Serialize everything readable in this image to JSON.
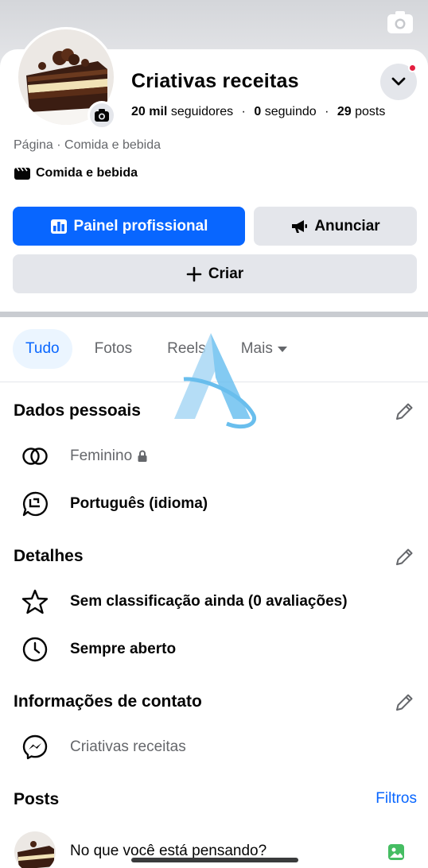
{
  "profile": {
    "name": "Criativas receitas",
    "followers_count": "20 mil",
    "followers_label": "seguidores",
    "following_count": "0",
    "following_label": "seguindo",
    "posts_count": "29",
    "posts_label": "posts",
    "page_category": "Página · Comida e bebida",
    "category_label": "Comida e bebida"
  },
  "actions": {
    "primary_label": "Painel profissional",
    "ad_label": "Anunciar",
    "create_label": "Criar"
  },
  "tabs": [
    {
      "label": "Tudo",
      "active": true
    },
    {
      "label": "Fotos",
      "active": false
    },
    {
      "label": "Reels",
      "active": false
    },
    {
      "label": "Mais",
      "active": false
    }
  ],
  "personal": {
    "title": "Dados pessoais",
    "gender": "Feminino",
    "language": "Português (idioma)"
  },
  "details": {
    "title": "Detalhes",
    "rating": "Sem classificação ainda (0 avaliações)",
    "hours": "Sempre aberto"
  },
  "contact": {
    "title": "Informações de contato",
    "messenger": "Criativas receitas"
  },
  "posts": {
    "title": "Posts",
    "filters_label": "Filtros",
    "composer_placeholder": "No que você está pensando?"
  },
  "colors": {
    "accent": "#0866ff",
    "notification": "#e41e3f",
    "button_gray": "#e4e6eb",
    "muted_text": "#65676b"
  },
  "icons": [
    "camera-icon",
    "chevron-down-icon",
    "clapperboard-icon",
    "dashboard-icon",
    "megaphone-icon",
    "plus-icon",
    "gender-icon",
    "lock-icon",
    "language-icon",
    "star-icon",
    "clock-icon",
    "messenger-icon",
    "pencil-icon",
    "photo-icon"
  ]
}
